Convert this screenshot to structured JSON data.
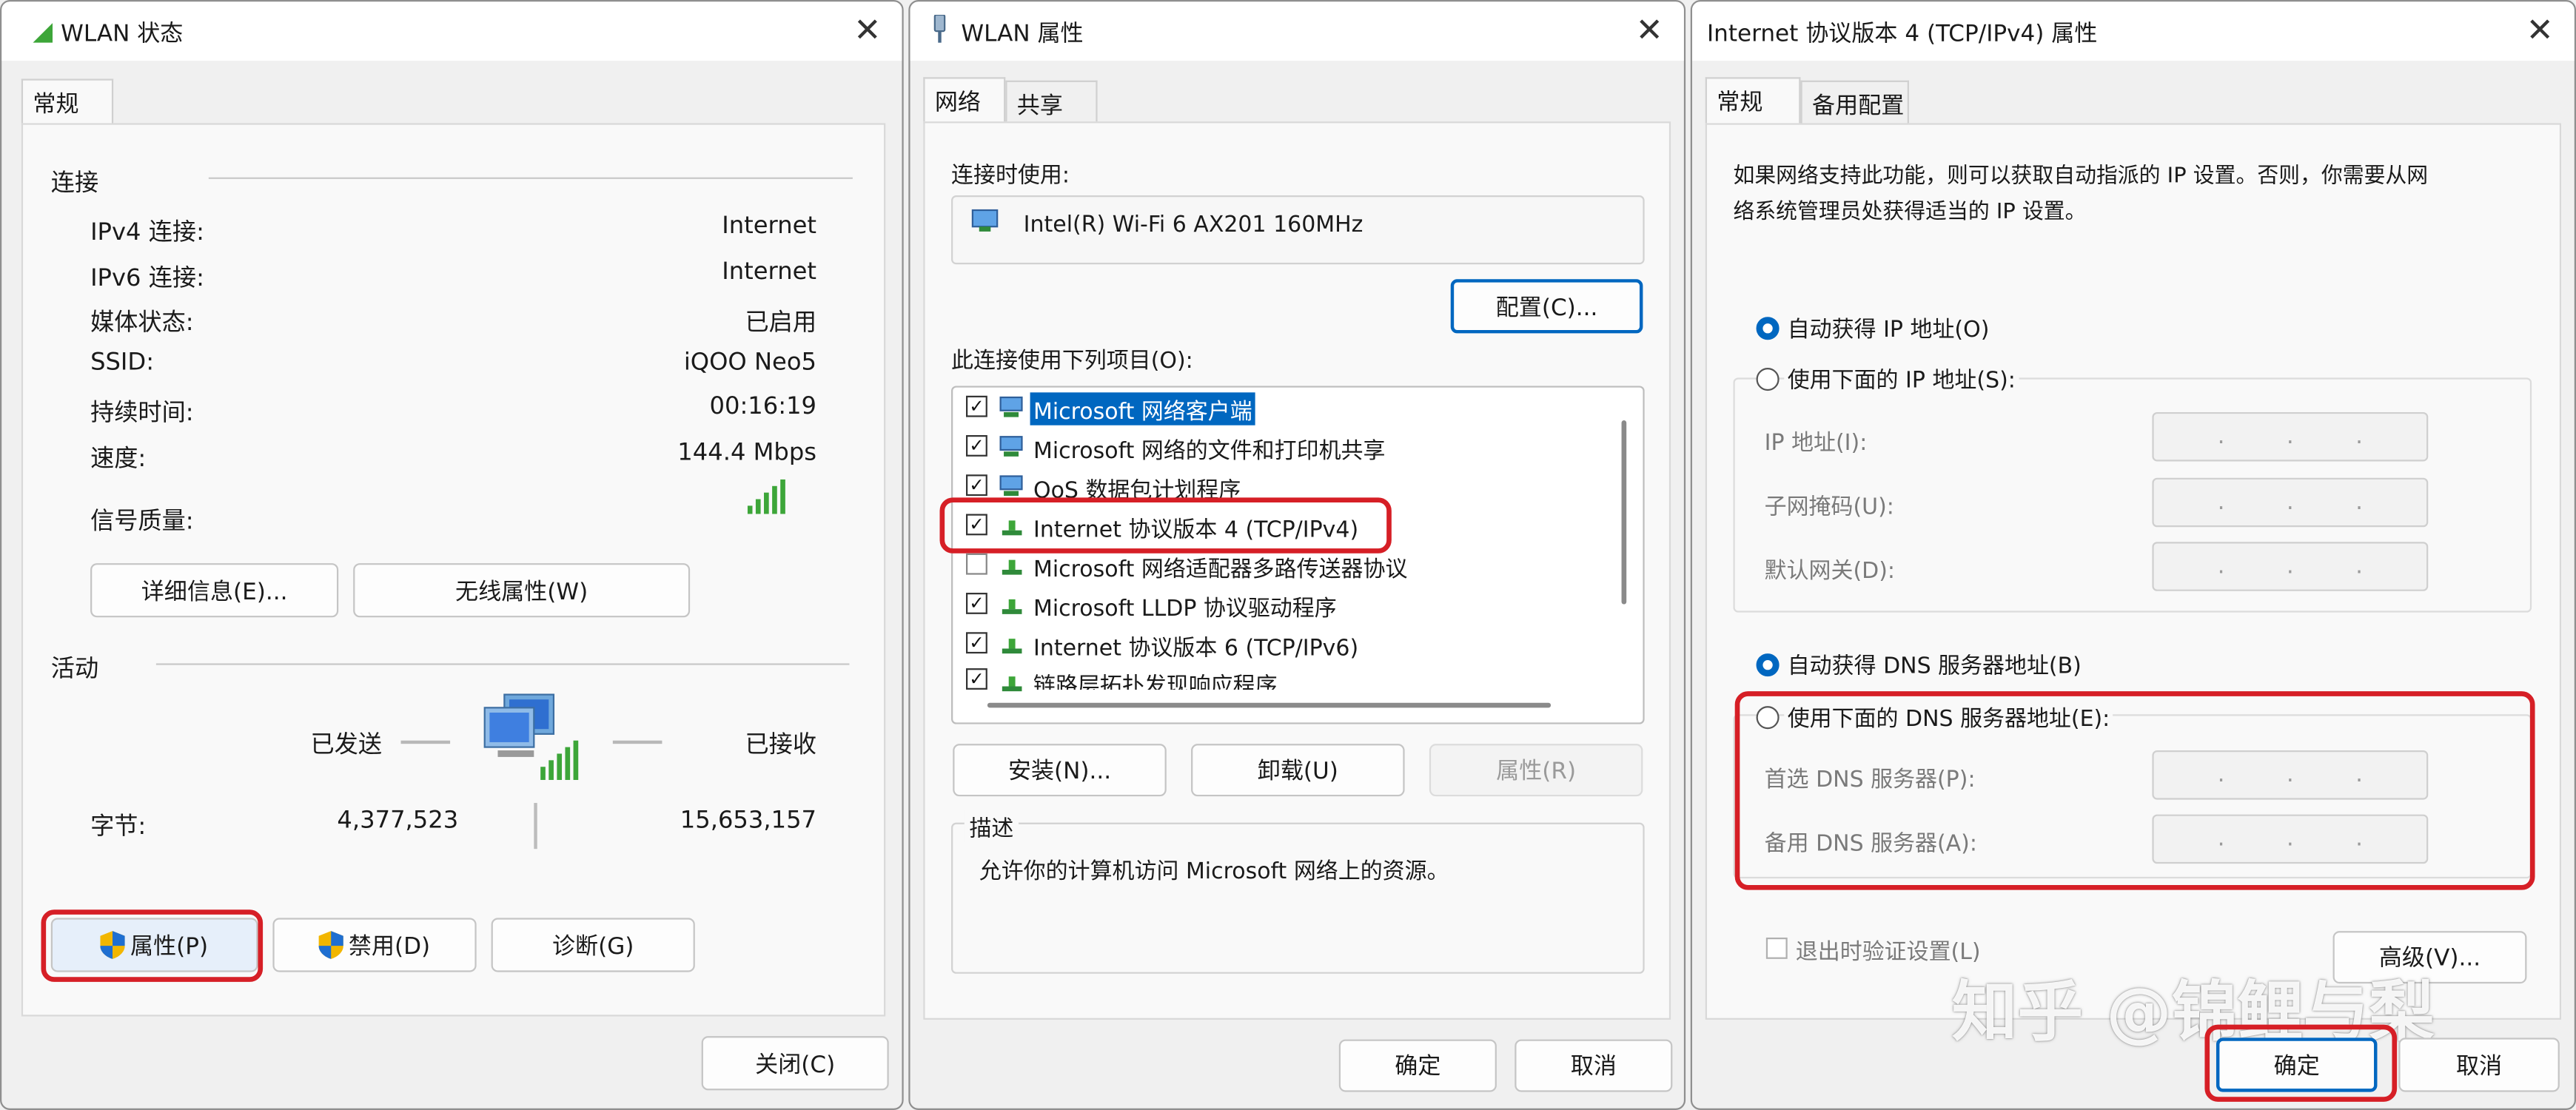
{
  "win1": {
    "title": "WLAN 状态",
    "tab": "常规",
    "connection_group": "连接",
    "rows": [
      {
        "label": "IPv4 连接:",
        "value": "Internet"
      },
      {
        "label": "IPv6 连接:",
        "value": "Internet"
      },
      {
        "label": "媒体状态:",
        "value": "已启用"
      },
      {
        "label": "SSID:",
        "value": "iQOO Neo5"
      },
      {
        "label": "持续时间:",
        "value": "00:16:19"
      },
      {
        "label": "速度:",
        "value": "144.4 Mbps"
      }
    ],
    "signal_label": "信号质量:",
    "details_button": "详细信息(E)...",
    "wireless_button": "无线属性(W)",
    "activity_group": "活动",
    "sent_label": "已发送",
    "received_label": "已接收",
    "bytes_label": "字节:",
    "bytes_sent": "4,377,523",
    "bytes_received": "15,653,157",
    "properties_button": "属性(P)",
    "disable_button": "禁用(D)",
    "diagnose_button": "诊断(G)",
    "close_button": "关闭(C)"
  },
  "win2": {
    "title": "WLAN 属性",
    "tabs": [
      "网络",
      "共享"
    ],
    "connect_using_label": "连接时使用:",
    "adapter_name": "Intel(R) Wi-Fi 6 AX201 160MHz",
    "configure_button": "配置(C)...",
    "items_label": "此连接使用下列项目(O):",
    "items": [
      {
        "label": "Microsoft 网络客户端",
        "checked": true
      },
      {
        "label": "Microsoft 网络的文件和打印机共享",
        "checked": true
      },
      {
        "label": "QoS 数据包计划程序",
        "checked": true
      },
      {
        "label": "Internet 协议版本 4 (TCP/IPv4)",
        "checked": true
      },
      {
        "label": "Microsoft 网络适配器多路传送器协议",
        "checked": false
      },
      {
        "label": "Microsoft LLDP 协议驱动程序",
        "checked": true
      },
      {
        "label": "Internet 协议版本 6 (TCP/IPv6)",
        "checked": true
      },
      {
        "label": "链路层拓扑发现响应程序",
        "checked": true
      }
    ],
    "install_button": "安装(N)...",
    "uninstall_button": "卸载(U)",
    "properties_button": "属性(R)",
    "description_group": "描述",
    "description_text": "允许你的计算机访问 Microsoft 网络上的资源。",
    "ok_button": "确定",
    "cancel_button": "取消"
  },
  "win3": {
    "title": "Internet 协议版本 4 (TCP/IPv4) 属性",
    "tabs": [
      "常规",
      "备用配置"
    ],
    "intro_line1": "如果网络支持此功能，则可以获取自动指派的 IP 设置。否则，你需要从网",
    "intro_line2": "络系统管理员处获得适当的 IP 设置。",
    "auto_ip": "自动获得 IP 地址(O)",
    "manual_ip": "使用下面的 IP 地址(S):",
    "ip_address": "IP 地址(I):",
    "subnet_mask": "子网掩码(U):",
    "gateway": "默认网关(D):",
    "auto_dns": "自动获得 DNS 服务器地址(B)",
    "manual_dns": "使用下面的 DNS 服务器地址(E):",
    "preferred_dns": "首选 DNS 服务器(P):",
    "alternate_dns": "备用 DNS 服务器(A):",
    "ip_dots": ".      .      .",
    "validate_on_exit": "退出时验证设置(L)",
    "advanced_button": "高级(V)...",
    "ok_button": "确定",
    "cancel_button": "取消",
    "ip_mode": "auto",
    "dns_mode": "auto"
  },
  "watermark": "知乎 @锦鲤与梨",
  "colors": {
    "accent": "#0067c0",
    "highlight_red": "#d61f26",
    "signal_green": "#3da639"
  }
}
